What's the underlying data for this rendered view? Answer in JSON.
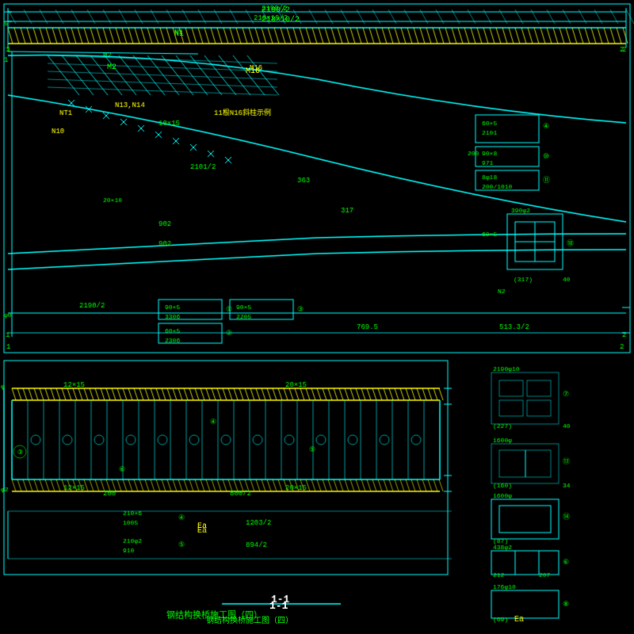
{
  "title": "钢结构换桥施工图（四）",
  "drawing_id": "1-1",
  "labels": {
    "top_dimension": "2190/2",
    "top_dimension2": "218×10/2",
    "n1": "N1",
    "m2": "M2",
    "m16": "M16",
    "n10": "N10",
    "n13_n14": "N13,N14",
    "nt1": "NT1",
    "spacing": "10×15",
    "note": "11根N16斜柱示例",
    "dim_2101_2": "2101/2",
    "dim_363": "363",
    "dim_317": "317",
    "dim_902": "902",
    "dim_902b": "902",
    "bottom_title": "1-1",
    "main_title": "钢结构换桥施工图（四）",
    "ea_label": "Ea"
  },
  "colors": {
    "background": "#000000",
    "cyan_lines": "#00ffff",
    "green_labels": "#00ff00",
    "yellow_labels": "#ffff00",
    "white_labels": "#ffffff",
    "hatching": "#ffff00"
  }
}
